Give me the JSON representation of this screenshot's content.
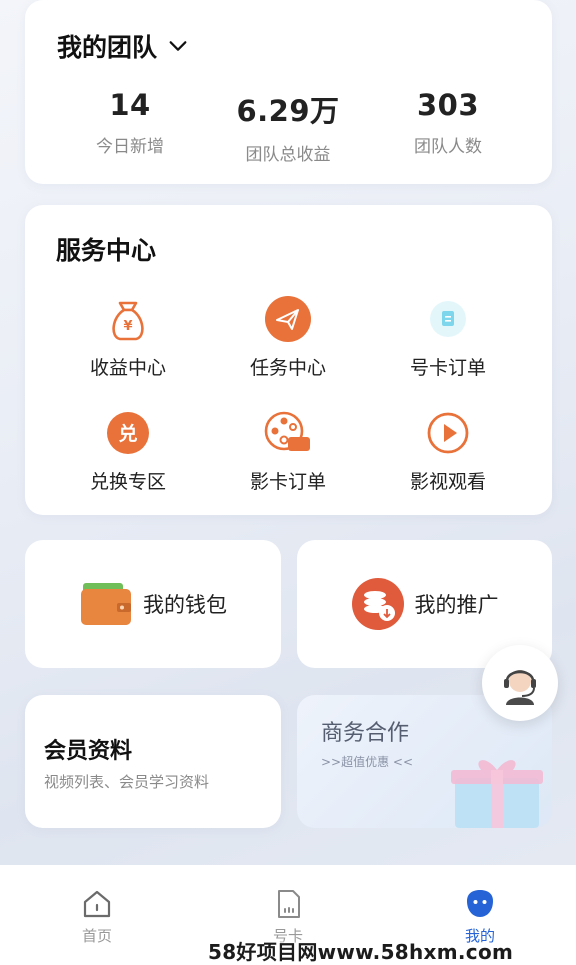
{
  "team": {
    "title": "我的团队",
    "stats": [
      {
        "value": "14",
        "label": "今日新增"
      },
      {
        "value": "6.29万",
        "label": "团队总收益"
      },
      {
        "value": "303",
        "label": "团队人数"
      }
    ]
  },
  "service": {
    "title": "服务中心",
    "items": [
      {
        "label": "收益中心",
        "icon": "money-bag-icon"
      },
      {
        "label": "任务中心",
        "icon": "paper-plane-icon"
      },
      {
        "label": "号卡订单",
        "icon": "sim-card-icon"
      },
      {
        "label": "兑换专区",
        "icon": "exchange-icon"
      },
      {
        "label": "影卡订单",
        "icon": "film-reel-icon"
      },
      {
        "label": "影视观看",
        "icon": "play-icon"
      }
    ]
  },
  "wallet": {
    "label": "我的钱包",
    "icon": "wallet-icon"
  },
  "promotion": {
    "label": "我的推广",
    "icon": "coins-icon"
  },
  "member": {
    "title": "会员资料",
    "subtitle": "视频列表、会员学习资料"
  },
  "business": {
    "title": "商务合作",
    "subtitle": ">>超值优惠 <<",
    "icon": "gift-box-icon"
  },
  "support": {
    "icon": "customer-service-icon"
  },
  "nav": {
    "items": [
      {
        "label": "首页",
        "icon": "home-icon",
        "active": false
      },
      {
        "label": "号卡",
        "icon": "sim-card-icon",
        "active": false
      },
      {
        "label": "我的",
        "icon": "profile-icon",
        "active": true
      }
    ]
  },
  "watermark": "58好项目网www.58hxm.com",
  "colors": {
    "accent_orange": "#e8723a",
    "accent_blue": "#2563d6",
    "muted_text": "#8a8a8a"
  }
}
